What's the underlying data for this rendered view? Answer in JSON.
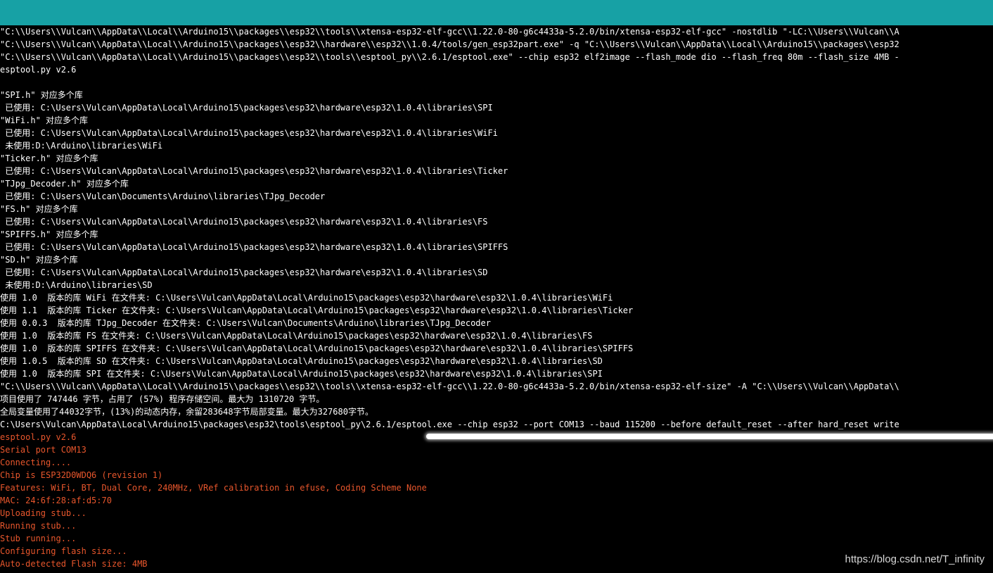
{
  "console": {
    "lines": [
      {
        "text": "\"C:\\\\Users\\\\Vulcan\\\\AppData\\\\Local\\\\Arduino15\\\\packages\\\\esp32\\\\tools\\\\xtensa-esp32-elf-gcc\\\\1.22.0-80-g6c4433a-5.2.0/bin/xtensa-esp32-elf-gcc\" -nostdlib \"-LC:\\\\Users\\\\Vulcan\\\\A",
        "kind": "normal"
      },
      {
        "text": "\"C:\\\\Users\\\\Vulcan\\\\AppData\\\\Local\\\\Arduino15\\\\packages\\\\esp32\\\\hardware\\\\esp32\\\\1.0.4/tools/gen_esp32part.exe\" -q \"C:\\\\Users\\\\Vulcan\\\\AppData\\\\Local\\\\Arduino15\\\\packages\\\\esp32",
        "kind": "normal"
      },
      {
        "text": "\"C:\\\\Users\\\\Vulcan\\\\AppData\\\\Local\\\\Arduino15\\\\packages\\\\esp32\\\\tools\\\\esptool_py\\\\2.6.1/esptool.exe\" --chip esp32 elf2image --flash_mode dio --flash_freq 80m --flash_size 4MB -",
        "kind": "normal"
      },
      {
        "text": "esptool.py v2.6",
        "kind": "normal"
      },
      {
        "text": "",
        "kind": "normal"
      },
      {
        "text": "\"SPI.h\" 对应多个库",
        "kind": "normal"
      },
      {
        "text": " 已使用: C:\\Users\\Vulcan\\AppData\\Local\\Arduino15\\packages\\esp32\\hardware\\esp32\\1.0.4\\libraries\\SPI",
        "kind": "normal"
      },
      {
        "text": "\"WiFi.h\" 对应多个库",
        "kind": "normal"
      },
      {
        "text": " 已使用: C:\\Users\\Vulcan\\AppData\\Local\\Arduino15\\packages\\esp32\\hardware\\esp32\\1.0.4\\libraries\\WiFi",
        "kind": "normal"
      },
      {
        "text": " 未使用:D:\\Arduino\\libraries\\WiFi",
        "kind": "normal"
      },
      {
        "text": "\"Ticker.h\" 对应多个库",
        "kind": "normal"
      },
      {
        "text": " 已使用: C:\\Users\\Vulcan\\AppData\\Local\\Arduino15\\packages\\esp32\\hardware\\esp32\\1.0.4\\libraries\\Ticker",
        "kind": "normal"
      },
      {
        "text": "\"TJpg_Decoder.h\" 对应多个库",
        "kind": "normal"
      },
      {
        "text": " 已使用: C:\\Users\\Vulcan\\Documents\\Arduino\\libraries\\TJpg_Decoder",
        "kind": "normal"
      },
      {
        "text": "\"FS.h\" 对应多个库",
        "kind": "normal"
      },
      {
        "text": " 已使用: C:\\Users\\Vulcan\\AppData\\Local\\Arduino15\\packages\\esp32\\hardware\\esp32\\1.0.4\\libraries\\FS",
        "kind": "normal"
      },
      {
        "text": "\"SPIFFS.h\" 对应多个库",
        "kind": "normal"
      },
      {
        "text": " 已使用: C:\\Users\\Vulcan\\AppData\\Local\\Arduino15\\packages\\esp32\\hardware\\esp32\\1.0.4\\libraries\\SPIFFS",
        "kind": "normal"
      },
      {
        "text": "\"SD.h\" 对应多个库",
        "kind": "normal"
      },
      {
        "text": " 已使用: C:\\Users\\Vulcan\\AppData\\Local\\Arduino15\\packages\\esp32\\hardware\\esp32\\1.0.4\\libraries\\SD",
        "kind": "normal"
      },
      {
        "text": " 未使用:D:\\Arduino\\libraries\\SD",
        "kind": "normal"
      },
      {
        "text": "使用 1.0  版本的库 WiFi 在文件夹: C:\\Users\\Vulcan\\AppData\\Local\\Arduino15\\packages\\esp32\\hardware\\esp32\\1.0.4\\libraries\\WiFi",
        "kind": "normal"
      },
      {
        "text": "使用 1.1  版本的库 Ticker 在文件夹: C:\\Users\\Vulcan\\AppData\\Local\\Arduino15\\packages\\esp32\\hardware\\esp32\\1.0.4\\libraries\\Ticker",
        "kind": "normal"
      },
      {
        "text": "使用 0.0.3  版本的库 TJpg_Decoder 在文件夹: C:\\Users\\Vulcan\\Documents\\Arduino\\libraries\\TJpg_Decoder",
        "kind": "normal"
      },
      {
        "text": "使用 1.0  版本的库 FS 在文件夹: C:\\Users\\Vulcan\\AppData\\Local\\Arduino15\\packages\\esp32\\hardware\\esp32\\1.0.4\\libraries\\FS",
        "kind": "normal"
      },
      {
        "text": "使用 1.0  版本的库 SPIFFS 在文件夹: C:\\Users\\Vulcan\\AppData\\Local\\Arduino15\\packages\\esp32\\hardware\\esp32\\1.0.4\\libraries\\SPIFFS",
        "kind": "normal"
      },
      {
        "text": "使用 1.0.5  版本的库 SD 在文件夹: C:\\Users\\Vulcan\\AppData\\Local\\Arduino15\\packages\\esp32\\hardware\\esp32\\1.0.4\\libraries\\SD",
        "kind": "normal"
      },
      {
        "text": "使用 1.0  版本的库 SPI 在文件夹: C:\\Users\\Vulcan\\AppData\\Local\\Arduino15\\packages\\esp32\\hardware\\esp32\\1.0.4\\libraries\\SPI",
        "kind": "normal"
      },
      {
        "text": "\"C:\\\\Users\\\\Vulcan\\\\AppData\\\\Local\\\\Arduino15\\\\packages\\\\esp32\\\\tools\\\\xtensa-esp32-elf-gcc\\\\1.22.0-80-g6c4433a-5.2.0/bin/xtensa-esp32-elf-size\" -A \"C:\\\\Users\\\\Vulcan\\\\AppData\\\\",
        "kind": "normal"
      },
      {
        "text": "项目使用了 747446 字节，占用了 (57%) 程序存储空间。最大为 1310720 字节。",
        "kind": "normal"
      },
      {
        "text": "全局变量使用了44032字节，(13%)的动态内存，余留283648字节局部变量。最大为327680字节。",
        "kind": "normal"
      },
      {
        "text": "C:\\Users\\Vulcan\\AppData\\Local\\Arduino15\\packages\\esp32\\tools\\esptool_py\\2.6.1/esptool.exe --chip esp32 --port COM13 --baud 115200 --before default_reset --after hard_reset write",
        "kind": "normal"
      },
      {
        "text": "esptool.py v2.6",
        "kind": "err"
      },
      {
        "text": "Serial port COM13",
        "kind": "err"
      },
      {
        "text": "Connecting....",
        "kind": "err"
      },
      {
        "text": "Chip is ESP32D0WDQ6 (revision 1)",
        "kind": "err"
      },
      {
        "text": "Features: WiFi, BT, Dual Core, 240MHz, VRef calibration in efuse, Coding Scheme None",
        "kind": "err"
      },
      {
        "text": "MAC: 24:6f:28:af:d5:70",
        "kind": "err"
      },
      {
        "text": "Uploading stub...",
        "kind": "err"
      },
      {
        "text": "Running stub...",
        "kind": "err"
      },
      {
        "text": "Stub running...",
        "kind": "err"
      },
      {
        "text": "Configuring flash size...",
        "kind": "err"
      },
      {
        "text": "Auto-detected Flash size: 4MB",
        "kind": "err"
      }
    ]
  },
  "watermark": {
    "text": "https://blog.csdn.net/T_infinity"
  },
  "colors": {
    "toolbar": "#17a1a5",
    "console_bg": "#000000",
    "normal_text": "#ffffff",
    "error_text": "#e8562c"
  }
}
